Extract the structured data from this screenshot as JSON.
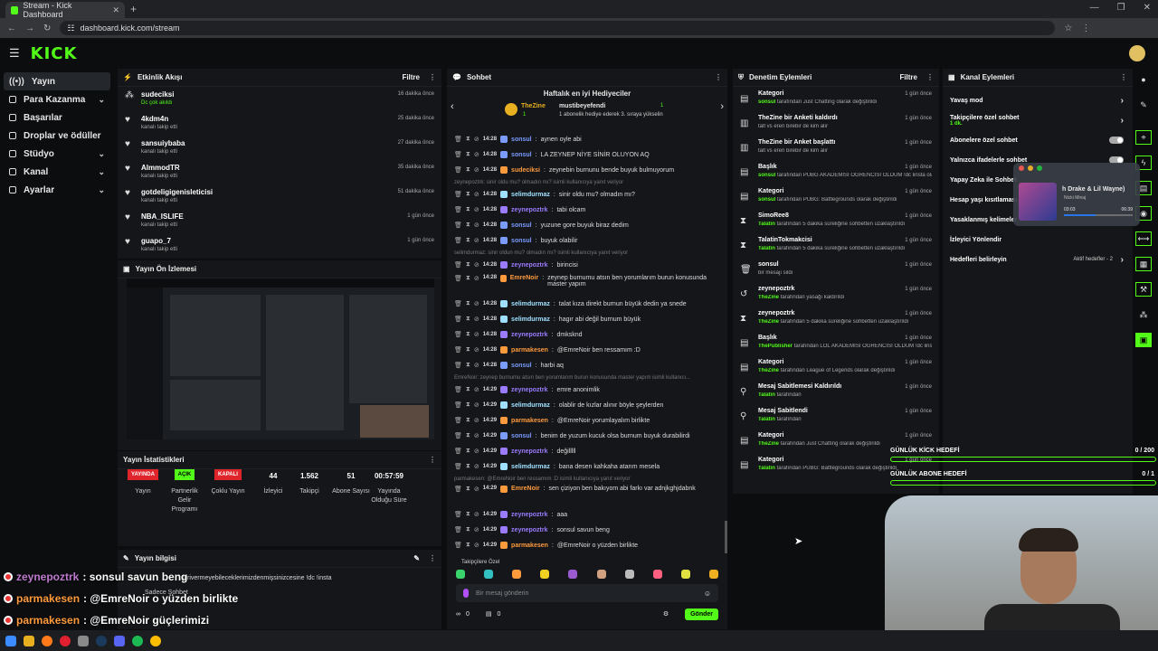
{
  "browser": {
    "tab_title": "Stream - Kick Dashboard",
    "url": "dashboard.kick.com/stream"
  },
  "brand": {
    "logo": "KICK",
    "accent": "#53fc18"
  },
  "sidebar": {
    "items": [
      {
        "label": "Yayın",
        "icon": "broadcast-icon"
      },
      {
        "label": "Para Kazanma",
        "icon": "money-icon"
      },
      {
        "label": "Başarılar",
        "icon": "trophy-icon"
      },
      {
        "label": "Droplar ve ödüller",
        "icon": "gift-icon"
      },
      {
        "label": "Stüdyo",
        "icon": "studio-icon"
      },
      {
        "label": "Kanal",
        "icon": "channel-icon"
      },
      {
        "label": "Ayarlar",
        "icon": "gear-icon"
      }
    ]
  },
  "activity": {
    "title": "Etkinlik Akışı",
    "filter": "Filtre",
    "items": [
      {
        "name": "sudeciksi",
        "sub": "Dc çok akıldı",
        "time": "16 dakika önce",
        "green": true
      },
      {
        "name": "4kdm4n",
        "sub": "kanalı takip etti",
        "time": "25 dakika önce"
      },
      {
        "name": "sansuiybaba",
        "sub": "kanalı takip etti",
        "time": "27 dakika önce"
      },
      {
        "name": "AlmmodTR",
        "sub": "kanalı takip etti",
        "time": "35 dakika önce"
      },
      {
        "name": "gotdeligigenisleticisi",
        "sub": "kanalı takip etti",
        "time": "51 dakika önce"
      },
      {
        "name": "NBA_ISLIFE",
        "sub": "kanalı takip etti",
        "time": "1 gün önce"
      },
      {
        "name": "guapo_7",
        "sub": "kanalı takip etti",
        "time": "1 gün önce"
      }
    ]
  },
  "preview": {
    "title": "Yayın Ön İzlemesi"
  },
  "stats": {
    "title": "Yayın İstatistikleri",
    "items": [
      {
        "value": "YAYINDA",
        "label": "Yayın",
        "badge": true,
        "color": "#e0242c"
      },
      {
        "value": "AÇIK",
        "label": "Partnerlik Gelir Programı",
        "badge": true,
        "color": "#53fc18"
      },
      {
        "value": "KAPALI",
        "label": "Çoklu Yayın",
        "badge": true,
        "color": "#e0242c"
      },
      {
        "value": "44",
        "label": "İzleyici"
      },
      {
        "value": "1.562",
        "label": "Takipçi"
      },
      {
        "value": "51",
        "label": "Abone Sayısı"
      },
      {
        "value": "00:57:59",
        "label": "Yayında Olduğu Süre"
      }
    ]
  },
  "info": {
    "title": "Yayın bilgisi",
    "sub": "Sadece Sohbet"
  },
  "chat": {
    "title": "Sohbet",
    "top_title": "Haftalık en iyi Hediyeciler",
    "top1_name": "TheZine",
    "top1_count": "1",
    "top2_name": "mustibeyefendi",
    "top2_count": "1",
    "top2_note": "1 abonelik hediye ederek 3. sıraya yükselin",
    "messages": [
      {
        "time": "14:28",
        "user": "sonsul",
        "color": "#7b9cff",
        "text": "aynen oyle abi"
      },
      {
        "time": "14:28",
        "user": "sonsul",
        "color": "#7b9cff",
        "text": "LA ZEYNEP NİYE SİNİR OLUYON AQ"
      },
      {
        "time": "14:28",
        "user": "sudeciksi",
        "color": "#ff9b3d",
        "text": "zeynebin burnunu bende buyuk bulmuyorum"
      },
      {
        "reply": "zeynepoztrk: sinir oldu mu? olmadın mı? isimli kullanıcıya yanıt veriyor"
      },
      {
        "time": "14:28",
        "user": "selimdurmaz",
        "color": "#a0e0ff",
        "text": "sinir oldu mu? olmadın mı?"
      },
      {
        "time": "14:28",
        "user": "zeynepoztrk",
        "color": "#9b7bff",
        "text": "tabi olcam"
      },
      {
        "time": "14:28",
        "user": "sonsul",
        "color": "#7b9cff",
        "text": "yuzune gore buyuk biraz dedim"
      },
      {
        "time": "14:28",
        "user": "sonsul",
        "color": "#7b9cff",
        "text": "buyuk olabilir"
      },
      {
        "reply": "selimdurmaz: sinir oldun mu? olmadın mı? isimli kullanıcıya yanıt veriyor"
      },
      {
        "time": "14:28",
        "user": "zeynepoztrk",
        "color": "#9b7bff",
        "text": "birincisi"
      },
      {
        "time": "14:28",
        "user": "EmreNoir",
        "color": "#ff9b3d",
        "text": "zeynep burnumu atsın ben yorumlarım burun konusunda master yapım"
      },
      {
        "time": "14:28",
        "user": "selimdurmaz",
        "color": "#a0e0ff",
        "text": "talat kıza direkt burnun büyük dedin ya snede"
      },
      {
        "time": "14:28",
        "user": "selimdurmaz",
        "color": "#a0e0ff",
        "text": "hagır abi değil burnum büyük"
      },
      {
        "time": "14:28",
        "user": "zeynepoztrk",
        "color": "#9b7bff",
        "text": "dmksknd"
      },
      {
        "time": "14:28",
        "user": "parmakesen",
        "color": "#ff9b3d",
        "text": "@EmreNoir ben ressamım :D"
      },
      {
        "time": "14:28",
        "user": "sonsul",
        "color": "#7b9cff",
        "text": "harbi aq"
      },
      {
        "reply": "EmreNoir: zeynep burnumu atsın ben yorumlarım burun konusunda master yapım isimli kullanıcı..."
      },
      {
        "time": "14:29",
        "user": "zeynepoztrk",
        "color": "#9b7bff",
        "text": "emre anonimlik"
      },
      {
        "time": "14:29",
        "user": "selimdurmaz",
        "color": "#a0e0ff",
        "text": "olablir de kızlar alınır böyle şeylerden"
      },
      {
        "time": "14:29",
        "user": "parmakesen",
        "color": "#ff9b3d",
        "text": "@EmreNoir yorumlayalım birlikte"
      },
      {
        "time": "14:29",
        "user": "sonsul",
        "color": "#7b9cff",
        "text": "benim de yuzum kucuk olsa burnum buyuk durabilirdi"
      },
      {
        "time": "14:29",
        "user": "zeynepoztrk",
        "color": "#9b7bff",
        "text": "değilllll"
      },
      {
        "time": "14:29",
        "user": "selimdurmaz",
        "color": "#a0e0ff",
        "text": "bana desen kahkaha atarım mesela"
      },
      {
        "reply": "parmakesen: @EmreNoir ben ressamım :D isimli kullanıcıya yanıt veriyor"
      },
      {
        "time": "14:29",
        "user": "EmreNoir",
        "color": "#ff9b3d",
        "text": "sen çiziyon ben bakıyom abi farkı var adnjkghjdabnk"
      },
      {
        "time": "14:29",
        "user": "zeynepoztrk",
        "color": "#9b7bff",
        "text": "aaa"
      },
      {
        "time": "14:29",
        "user": "zeynepoztrk",
        "color": "#9b7bff",
        "text": "sonsul savun beng"
      },
      {
        "time": "14:29",
        "user": "parmakesen",
        "color": "#ff9b3d",
        "text": "@EmreNoir o yüzden birlikte"
      },
      {
        "time": "14:29",
        "user": "parmakesen",
        "color": "#ff9b3d",
        "text": "@EmreNoir güçlerimizi"
      }
    ],
    "emote_label": "Takipçilere Özel",
    "input_placeholder": "Bir mesaj gönderin",
    "send": "Gönder",
    "count_a": "0",
    "count_b": "0"
  },
  "moderation": {
    "title": "Denetim Eylemleri",
    "filter": "Filtre",
    "items": [
      {
        "icon": "category-icon",
        "title": "Kategori",
        "who": "sonsul",
        "text": "tarafından Just Chatting olarak değiştirildi",
        "time": "1 gün önce"
      },
      {
        "icon": "poll-icon",
        "title": "TheZine bir Anketi kaldırdı",
        "who": "",
        "text": "talt vs eren birebir de kim alır",
        "time": "1 gün önce"
      },
      {
        "icon": "poll-icon",
        "title": "TheZine bir Anket başlattı",
        "who": "",
        "text": "talt vs eren birebir de kim alır",
        "time": "1 gün önce"
      },
      {
        "icon": "title-icon",
        "title": "Başlık",
        "who": "sonsul",
        "text": "tarafından PUBG AKADEMİSİ ÖĞRENCİSİ OLDUM !dc linsta olarak değiştirildi",
        "time": "1 gün önce"
      },
      {
        "icon": "category-icon",
        "title": "Kategori",
        "who": "sonsul",
        "text": "tarafından PUBG: Battlegrounds olarak değiştirildi",
        "time": "1 gün önce"
      },
      {
        "icon": "timeout-icon",
        "title": "SimoRee8",
        "who": "Talatin",
        "text": "tarafından 5 dakika süreliğine sohbetten uzaklaştırıldı",
        "time": "1 gün önce"
      },
      {
        "icon": "timeout-icon",
        "title": "TalatinTokmakcisi",
        "who": "Talatin",
        "text": "tarafından 5 dakika süreliğine sohbetten uzaklaştırıldı",
        "time": "1 gün önce"
      },
      {
        "icon": "trash-icon",
        "title": "sonsul",
        "who": "",
        "text": "bir mesajı sildi",
        "time": "1 gün önce"
      },
      {
        "icon": "unban-icon",
        "title": "zeynepoztrk",
        "who": "TheZine",
        "text": "tarafından yasağı kaldırıldı",
        "time": "1 gün önce"
      },
      {
        "icon": "timeout-icon",
        "title": "zeynepoztrk",
        "who": "TheZine",
        "text": "tarafından 5 dakika süreliğine sohbetten uzaklaştırıldı",
        "time": "1 gün önce"
      },
      {
        "icon": "title-icon",
        "title": "Başlık",
        "who": "ThePublisher",
        "text": "tarafından LOL AKADEMİSİ ÖĞRENCİSİ OLDUM !dc linsta olarak değiştirildi",
        "time": "1 gün önce"
      },
      {
        "icon": "category-icon",
        "title": "Kategori",
        "who": "TheZine",
        "text": "tarafından League of Legends olarak değiştirildi",
        "time": "1 gün önce"
      },
      {
        "icon": "unpin-icon",
        "title": "Mesaj Sabitlemesi Kaldırıldı",
        "who": "Talatin",
        "text": "tarafından",
        "time": "1 gün önce"
      },
      {
        "icon": "pin-icon",
        "title": "Mesaj Sabitlendi",
        "who": "Talatin",
        "text": "tarafından",
        "time": "1 gün önce"
      },
      {
        "icon": "category-icon",
        "title": "Kategori",
        "who": "TheZine",
        "text": "tarafından Just Chatting olarak değiştirildi",
        "time": "1 gün önce"
      },
      {
        "icon": "category-icon",
        "title": "Kategori",
        "who": "Talatin",
        "text": "tarafından PUBG: Battlegrounds olarak değiştirildi",
        "time": "1 gün önce"
      }
    ]
  },
  "channel": {
    "title": "Kanal Eylemleri",
    "items": [
      {
        "label": "Yavaş mod",
        "type": "arrow"
      },
      {
        "label": "Takipçilere özel sohbet",
        "sub": "1 dk.",
        "type": "arrow"
      },
      {
        "label": "Abonelere özel sohbet",
        "type": "toggle"
      },
      {
        "label": "Yalnızca ifadelerle sohbet",
        "type": "toggle"
      },
      {
        "label": "Yapay Zeka ile Sohbet",
        "type": "none"
      },
      {
        "label": "Hesap yaşı kısıtlaması",
        "type": "none"
      },
      {
        "label": "Yasaklanmış kelimeler",
        "type": "none"
      },
      {
        "label": "İzleyici Yönlendir",
        "type": "none"
      },
      {
        "label": "Hedefleri belirleyin",
        "note": "Aktif hedefler - 2",
        "type": "arrow"
      }
    ]
  },
  "music": {
    "title": "h Drake & Lil Wayne)",
    "artist": "Nicki Minaj",
    "elapsed": "03:03",
    "total": "06:39",
    "progress": 0.46
  },
  "goals": [
    {
      "label": "GÜNLÜK KİCK HEDEFİ",
      "value": "0 / 200"
    },
    {
      "label": "GÜNLÜK ABONE HEDEFİ",
      "value": "0 / 1"
    }
  ],
  "overlay_chat": [
    {
      "user": "zeynepoztrk",
      "text": ": sonsul savun beng"
    },
    {
      "user": "parmakesen",
      "text": ": @EmreNoir o yüzden birlikte"
    },
    {
      "user": "parmakesen",
      "text": ": @EmreNoir güçlerimizi"
    }
  ],
  "overlay_ghost": "ştirivermeyebileceklerimizdenmişsinizcesine !dc !insta"
}
